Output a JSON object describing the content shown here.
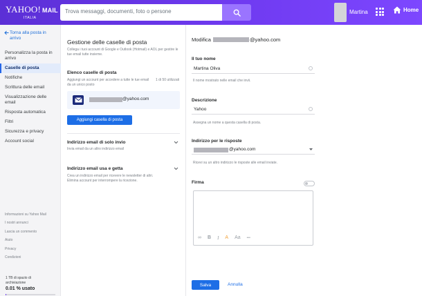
{
  "header": {
    "logo_main": "YAHOO!",
    "logo_mail": "MAIL",
    "logo_sub": "ITALIA",
    "search_placeholder": "Trova messaggi, documenti, foto o persone",
    "user_name": "Martina",
    "home_label": "Home"
  },
  "sidebar": {
    "back_label": "Torna alla posta in arrivo",
    "items": [
      {
        "label": "Personalizza la posta in arrivo",
        "active": false
      },
      {
        "label": "Caselle di posta",
        "active": true
      },
      {
        "label": "Notifiche",
        "active": false
      },
      {
        "label": "Scrittura delle email",
        "active": false
      },
      {
        "label": "Visualizzazione delle email",
        "active": false
      },
      {
        "label": "Risposta automatica",
        "active": false
      },
      {
        "label": "Filtri",
        "active": false
      },
      {
        "label": "Sicurezza e privacy",
        "active": false
      },
      {
        "label": "Account social",
        "active": false
      }
    ],
    "footer_links": [
      "Informazioni su Yahoo Mail",
      "I nostri annunci",
      "Lascia un commento",
      "Aiuto",
      "Privacy",
      "Condizioni"
    ],
    "storage_line1": "1 TB di spazio di",
    "storage_line2": "archiviazione",
    "storage_pct": "0.01 % usato",
    "storage_fraction": 0.0001
  },
  "middle": {
    "title": "Gestione delle caselle di posta",
    "description": "Collega i tuoi account di Google e Outlook (Hotmail) e AOL per gestire le tue email tutte insieme.",
    "list_title": "Elenco caselle di posta",
    "list_desc": "Aggiungi un account per accedere a tutte le tue email da un unico posto",
    "list_count": "1 di 50 utilizzati",
    "account_domain": "@yahoo.com",
    "add_button": "Aggiungi casella di posta",
    "send_only_title": "Indirizzo email di solo invio",
    "send_only_desc": "Invia email da un altro indirizzo email",
    "disposable_title": "Indirizzo email usa e getta",
    "disposable_desc": "Crea un indirizzo email per ricevere le newsletter di altri. Elimina account per interrompere la ricezione."
  },
  "right": {
    "title_prefix": "Modifica",
    "title_domain": "@yahoo.com",
    "name_label": "Il tuo nome",
    "name_value": "Martina Oliva",
    "name_help": "Il nome mostrato nelle email che invii.",
    "desc_label": "Descrizione",
    "desc_value": "Yahoo",
    "desc_help": "Assegna un nome a questa casella di posta.",
    "reply_label": "Indirizzo per le risposte",
    "reply_domain": "@yahoo.com",
    "reply_help": "Ricevi su un altro indirizzo le risposte alle email inviate.",
    "signature_label": "Firma",
    "tools": [
      "∞",
      "B",
      "I",
      "A",
      "Aa",
      "•••"
    ],
    "save_label": "Salva",
    "cancel_label": "Annulla"
  }
}
